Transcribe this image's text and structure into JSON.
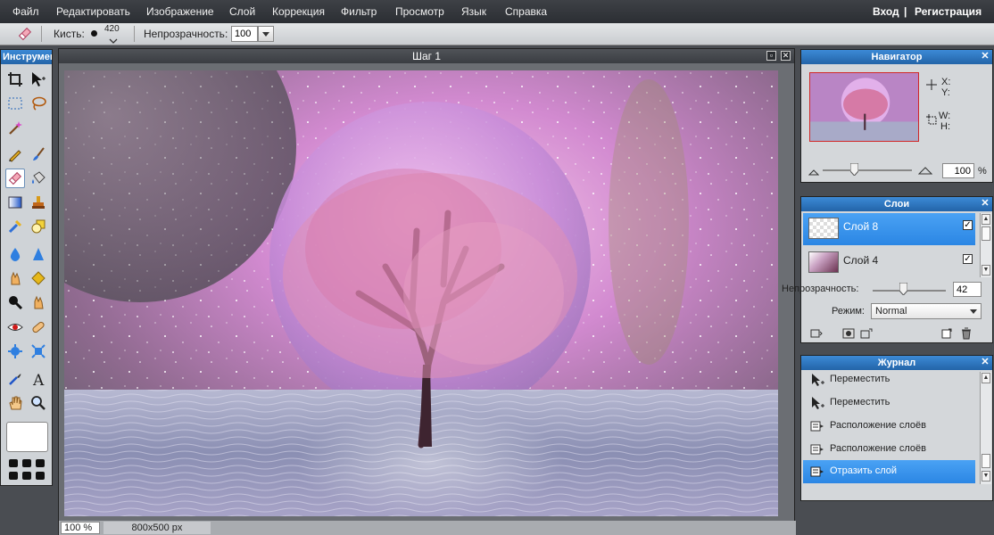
{
  "menubar": {
    "items": [
      "Файл",
      "Редактировать",
      "Изображение",
      "Слой",
      "Коррекция",
      "Фильтр",
      "Просмотр",
      "Язык",
      "Справка"
    ],
    "login": "Вход",
    "separator": "|",
    "register": "Регистрация"
  },
  "toolbar": {
    "brush_label": "Кисть:",
    "brush_size": "420",
    "opacity_label": "Непрозрачность:",
    "opacity_value": "100"
  },
  "tools": {
    "title": "Инструменты"
  },
  "canvas": {
    "title": "Шаг 1",
    "zoom": "100",
    "zoom_unit": "%",
    "dimensions": "800x500 px"
  },
  "navigator": {
    "title": "Навигатор",
    "x_label": "X:",
    "y_label": "Y:",
    "w_label": "W:",
    "h_label": "H:",
    "zoom_value": "100",
    "zoom_unit": "%",
    "zoom_slider_level": 0.35
  },
  "layers": {
    "title": "Слои",
    "items": [
      {
        "name": "Слой 8",
        "selected": true,
        "visible": true
      },
      {
        "name": "Слой 4",
        "selected": false,
        "visible": true
      }
    ],
    "opacity_label": "Непрозрачность:",
    "opacity_value": "42",
    "mode_label": "Режим:",
    "mode_value": "Normal"
  },
  "history": {
    "title": "Журнал",
    "items": [
      {
        "label": "Переместить",
        "icon": "move-icon",
        "selected": false
      },
      {
        "label": "Переместить",
        "icon": "move-icon",
        "selected": false
      },
      {
        "label": "Расположение слоёв",
        "icon": "layer-arrange-icon",
        "selected": false
      },
      {
        "label": "Расположение слоёв",
        "icon": "layer-arrange-icon",
        "selected": false
      },
      {
        "label": "Отразить слой",
        "icon": "flip-layer-icon",
        "selected": true
      }
    ]
  },
  "colors": {
    "accent": "#2b8ae8",
    "selected_row": "#3a93ee",
    "panel_head": "#2c70bc"
  }
}
